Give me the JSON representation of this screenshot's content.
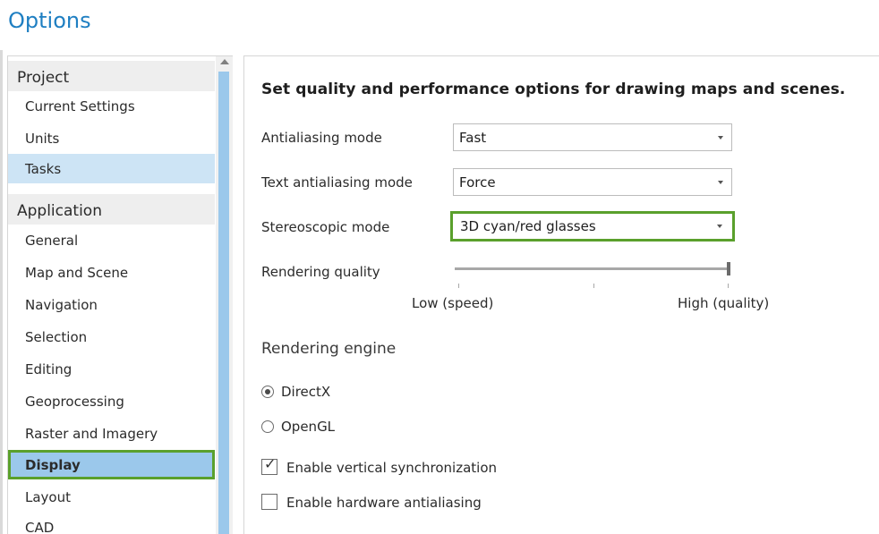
{
  "window": {
    "title": "Options"
  },
  "sidebar": {
    "groups": [
      {
        "label": "Project",
        "items": [
          "Current Settings",
          "Units",
          "Tasks"
        ]
      },
      {
        "label": "Application",
        "items": [
          "General",
          "Map and Scene",
          "Navigation",
          "Selection",
          "Editing",
          "Geoprocessing",
          "Raster and Imagery",
          "Display",
          "Layout",
          "CAD"
        ]
      }
    ],
    "selected_item": "Tasks",
    "active_item": "Display"
  },
  "display": {
    "heading": "Set quality and performance options for drawing maps and scenes.",
    "antialiasing": {
      "label": "Antialiasing mode",
      "value": "Fast"
    },
    "text_antialiasing": {
      "label": "Text antialiasing mode",
      "value": "Force"
    },
    "stereoscopic": {
      "label": "Stereoscopic mode",
      "value": "3D cyan/red glasses"
    },
    "rendering_quality": {
      "label": "Rendering quality",
      "low_label": "Low (speed)",
      "high_label": "High (quality)",
      "level": 1.0
    },
    "rendering_engine": {
      "title": "Rendering engine",
      "options": [
        "DirectX",
        "OpenGL"
      ],
      "selected": "DirectX"
    },
    "vsync": {
      "label": "Enable vertical synchronization",
      "checked": true
    },
    "hw_antialiasing": {
      "label": "Enable hardware antialiasing",
      "checked": false
    }
  },
  "icons": {
    "dropdown": "chevron-down-icon",
    "scroll_up": "scroll-up-arrow-icon",
    "check": "checkmark-icon"
  },
  "colors": {
    "title": "#1f7fc2",
    "highlight_outline": "#5aa02c",
    "selected_bg": "#cde4f5",
    "active_bg": "#9bc8eb"
  }
}
